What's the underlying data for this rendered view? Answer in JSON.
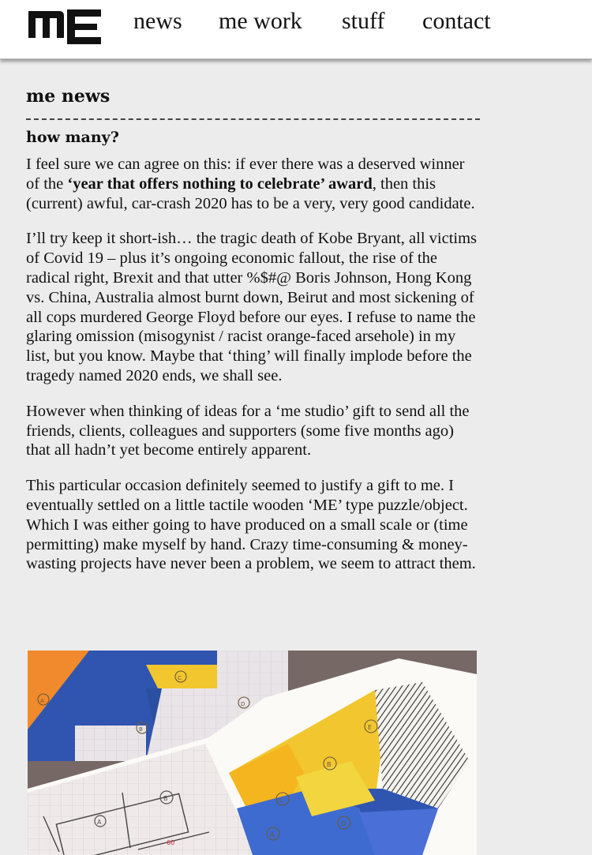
{
  "header": {
    "logo_alt": "me",
    "nav": [
      "news",
      "me work",
      "stuff",
      "contact"
    ]
  },
  "main": {
    "page_title": "me news",
    "post_title": "how many?",
    "paragraph1": {
      "before": "I feel sure we can agree on this: if ever there was a deserved winner of the ",
      "bold": "‘year that offers nothing to celebrate’ award",
      "after": ", then this (current) awful, car-crash 2020 has to be a very, very good candidate."
    },
    "paragraph2": "I’ll try keep it short-ish… the tragic death of Kobe Bryant, all victims of Covid 19 – plus it’s ongoing economic fallout, the rise of the radical right, Brexit and that utter %$#@ Boris Johnson, Hong Kong vs. China, Australia almost burnt down, Beirut and most sickening of all cops murdered George Floyd before our eyes. I refuse to name the glaring omission (misogynist / racist orange-faced arsehole) in my list, but you know. Maybe that ‘thing’ will finally implode before the tragedy named 2020 ends, we shall see.",
    "paragraph3": "However when thinking of ideas for a ‘me studio’ gift to send all the friends, clients, colleagues and supporters (some five months ago) that all hadn’t yet become entirely apparent.",
    "paragraph4": "This particular occasion definitely seemed to justify a gift to me. I eventually settled on a little tactile wooden ‘ME’ type puzzle/object. Which I was either going to have produced on a small scale or (time permitting) make myself by hand. Crazy time-consuming & money-wasting projects have never been a problem, we seem to attract them.",
    "photo_labels": [
      "A",
      "B",
      "C",
      "D",
      "E",
      "A",
      "B",
      "C",
      "D",
      "A",
      "B",
      "60"
    ]
  },
  "colors": {
    "background": "#ececec",
    "header": "#ffffff",
    "text": "#111111",
    "puzzle_blue": "#2f55b0",
    "puzzle_yellow": "#f2c62f",
    "puzzle_orange": "#f08a2c"
  }
}
